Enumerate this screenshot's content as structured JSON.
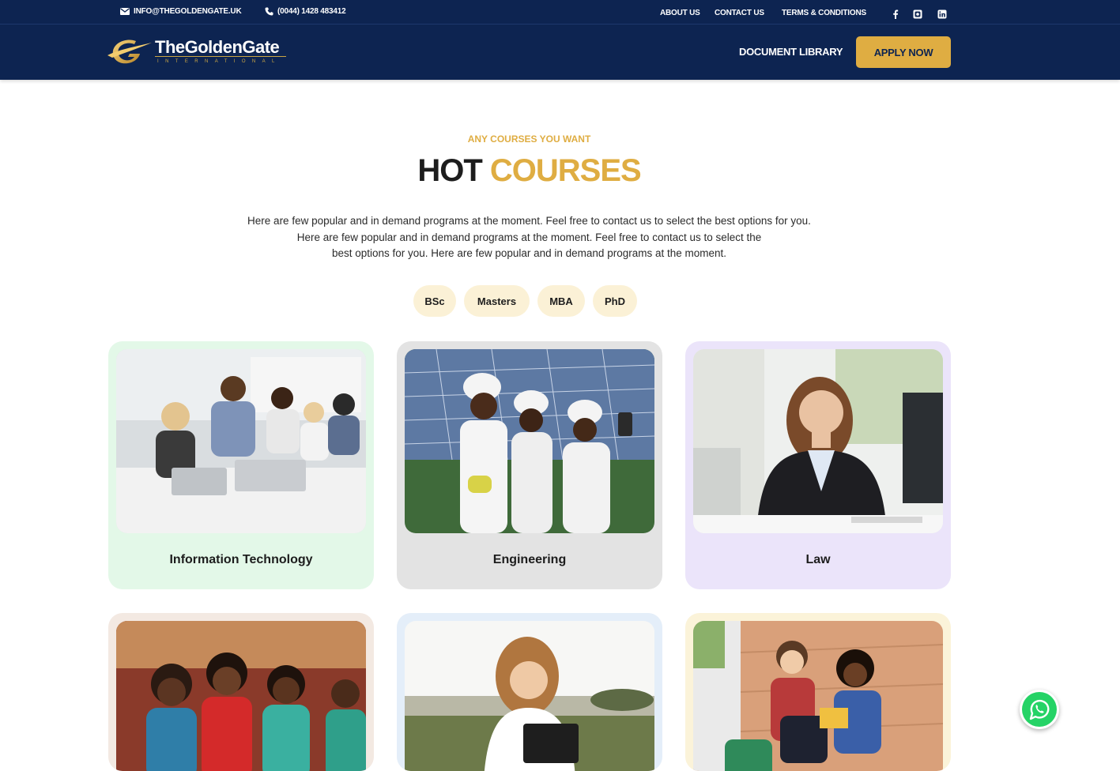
{
  "topbar": {
    "email": "INFO@THEGOLDENGATE.UK",
    "phone": "(0044) 1428 483412",
    "links": [
      "ABOUT US",
      "CONTACT US",
      "TERMS & CONDITIONS"
    ],
    "social_icons": [
      "facebook-icon",
      "instagram-icon",
      "linkedin-icon"
    ]
  },
  "navbar": {
    "logo_title": "TheGoldenGate",
    "logo_subtitle": "INTERNATIONAL",
    "document_library": "DOCUMENT LIBRARY",
    "apply_now": "APPLY NOW"
  },
  "section": {
    "eyebrow": "ANY COURSES YOU WANT",
    "heading_part1": "HOT",
    "heading_part2": "COURSES",
    "intro_line1": "Here are few popular and in demand programs at the moment. Feel free to contact us to select the best options for you.",
    "intro_line2": "Here are few popular and in demand programs at the moment. Feel free to contact us to select the",
    "intro_line3": "best options for you. Here are few popular and in demand programs at the moment."
  },
  "filters": [
    "BSc",
    "Masters",
    "MBA",
    "PhD"
  ],
  "courses": [
    {
      "title": "Information Technology",
      "bg": "#e3f8e8"
    },
    {
      "title": "Engineering",
      "bg": "#e3e3e3"
    },
    {
      "title": "Law",
      "bg": "#ebe4fa"
    },
    {
      "title": "",
      "bg": "#f3e9e2"
    },
    {
      "title": "",
      "bg": "#e4eef9"
    },
    {
      "title": "",
      "bg": "#fbf3d9"
    }
  ],
  "colors": {
    "navy": "#0d2451",
    "gold": "#dfad42",
    "whatsapp": "#25d366"
  }
}
